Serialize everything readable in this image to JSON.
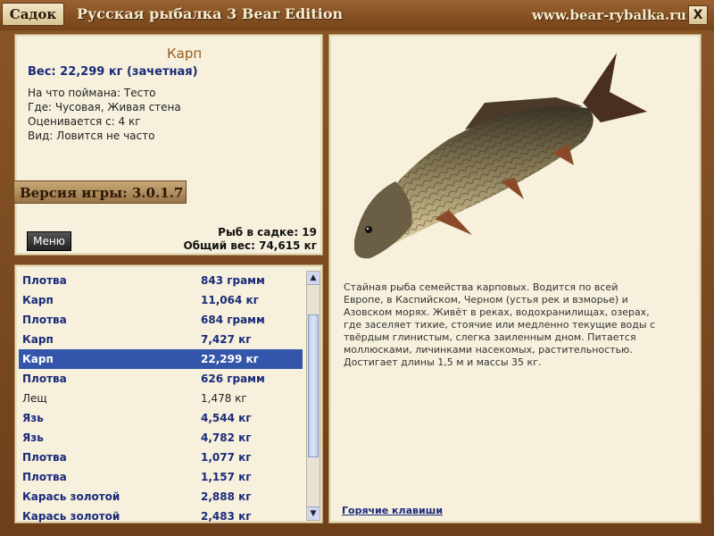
{
  "titlebar": {
    "tab_label": "Садок",
    "app_title": "Русская рыбалка 3 Bear Edition",
    "site_url": "www.bear-rybalka.ru",
    "close_label": "X"
  },
  "info": {
    "fish_name": "Карп",
    "weight": "Вес: 22,299 кг (зачетная)",
    "bait": "На что поймана: Тесто",
    "location": "Где: Чусовая, Живая стена",
    "rated_from": "Оценивается с: 4 кг",
    "kind": "Вид: Ловится не часто",
    "version": "Версия игры: 3.0.1.7",
    "menu_label": "Меню",
    "fish_count": "Рыб в садке: 19",
    "total_weight": "Общий вес: 74,615 кг"
  },
  "list": [
    {
      "name": "Плотва",
      "weight": "843 грамм",
      "style": "bold"
    },
    {
      "name": "Карп",
      "weight": "11,064 кг",
      "style": "bold"
    },
    {
      "name": "Плотва",
      "weight": "684 грамм",
      "style": "bold"
    },
    {
      "name": "Карп",
      "weight": "7,427 кг",
      "style": "bold"
    },
    {
      "name": "Карп",
      "weight": "22,299 кг",
      "style": "selected"
    },
    {
      "name": "Плотва",
      "weight": "626 грамм",
      "style": "bold"
    },
    {
      "name": "Лещ",
      "weight": "1,478 кг",
      "style": "plain"
    },
    {
      "name": "Язь",
      "weight": "4,544 кг",
      "style": "bold"
    },
    {
      "name": "Язь",
      "weight": "4,782 кг",
      "style": "bold"
    },
    {
      "name": "Плотва",
      "weight": "1,077 кг",
      "style": "bold"
    },
    {
      "name": "Плотва",
      "weight": "1,157 кг",
      "style": "bold"
    },
    {
      "name": "Карась золотой",
      "weight": "2,888 кг",
      "style": "bold"
    },
    {
      "name": "Карась золотой",
      "weight": "2,483 кг",
      "style": "bold"
    }
  ],
  "scroll": {
    "up_icon": "▲",
    "down_icon": "▼"
  },
  "description": {
    "lines": [
      "Стайная рыба семейства карповых. Водится по всей",
      "Европе, в Каспийском, Черном (устья рек и взморье) и",
      "Азовском морях. Живёт в реках, водохранилищах, озерах,",
      "где заселяет тихие, стоячие или медленно текущие воды с",
      "твёрдым глинистым, слегка заиленным дном. Питается",
      "моллюсками, личинками насекомых, растительностью.",
      "Достигает длины 1,5 м и массы 35 кг."
    ],
    "hotkeys_label": "Горячие клавиши"
  }
}
